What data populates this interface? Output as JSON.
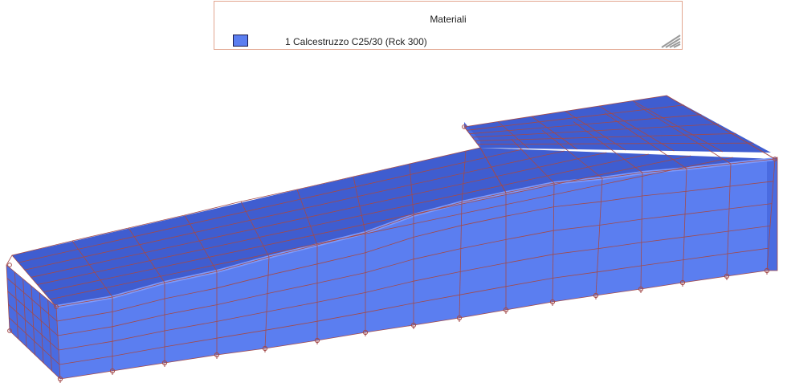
{
  "legend": {
    "title": "Materiali",
    "items": [
      {
        "label": "1 Calcestruzzo C25/30 (Rck 300)",
        "color": "#5b7ef0"
      }
    ]
  },
  "colors": {
    "top_face": "#3f5dd0",
    "side_face": "#5b7ef0",
    "end_face": "#4a6be0",
    "mesh_line": "#a34a4a",
    "legend_border": "#e2a58f"
  }
}
